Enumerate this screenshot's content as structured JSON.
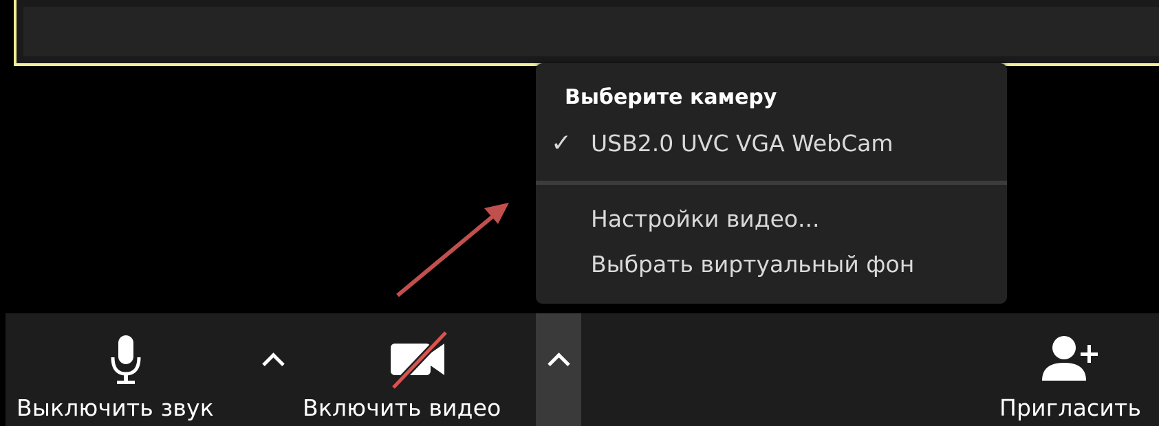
{
  "camera_menu": {
    "title": "Выберите камеру",
    "camera_item": "USB2.0 UVC VGA WebCam",
    "check_mark": "✓",
    "video_settings": "Настройки видео...",
    "virtual_background": "Выбрать виртуальный фон"
  },
  "toolbar": {
    "mute_label": "Выключить звук",
    "video_label": "Включить видео",
    "invite_label": "Пригласить",
    "invite_plus": "+"
  },
  "icons": {
    "microphone": "microphone-icon",
    "video_off": "video-off-icon",
    "invite": "add-participant-icon",
    "caret": "chevron-up-icon",
    "annotation": "red-arrow"
  },
  "colors": {
    "toolbar_bg": "#1d1d1d",
    "menu_bg": "#232323",
    "active_speaker_border": "#f0ef9a",
    "video_off_slash": "#d9534f",
    "annotation_arrow": "#c0504d"
  }
}
